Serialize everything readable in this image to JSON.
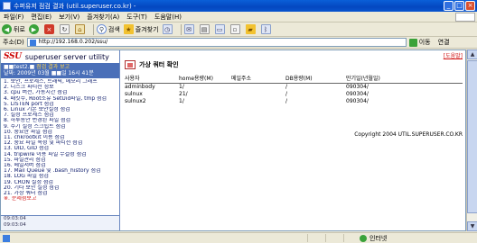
{
  "window": {
    "title": "수퍼유저 점검 결과 (util.superuser.co.kr) - ",
    "min_label": "_",
    "max_label": "□",
    "close_label": "×"
  },
  "menubar": [
    "파일(F)",
    "편집(E)",
    "보기(V)",
    "즐겨찾기(A)",
    "도구(T)",
    "도움말(H)"
  ],
  "toolbar": {
    "back_label": "뒤로",
    "search_label": "검색",
    "favorites_label": "즐겨찾기"
  },
  "address": {
    "label": "주소(D)",
    "url": "http://192.168.0.202/ssu/",
    "go_label": "이동",
    "links_label": "연결"
  },
  "sidebar": {
    "logo_mark": "SSU",
    "logo_text": "superuser server utility",
    "header_prefix": "■■test2.■",
    "header_warn": "점검 결과 보고",
    "header_line2": "날짜: 2009년 03월 ■■일 16시 41분",
    "items": [
      {
        "label": "1. 보안, 프로세스, 트래픽, 메모리 그래프",
        "red": false
      },
      {
        "label": "2. 디스크 파티션 정보",
        "red": false
      },
      {
        "label": "3. cpu 버전, 가동시간 점검",
        "red": false
      },
      {
        "label": "4. 패킷수, Root소유 SetUid파일, tmp 점검",
        "red": false
      },
      {
        "label": "5. LISTEN port 점검",
        "red": false
      },
      {
        "label": "6. Linux 기본 보안설정 점검",
        "red": false
      },
      {
        "label": "7. 설정 프로세스 점검",
        "red": false
      },
      {
        "label": "8. 하루동안 변경된 파일 점검",
        "red": false
      },
      {
        "label": "9. 주기 설정 스크립트 점검",
        "red": false
      },
      {
        "label": "10. 중요한 파일 점검",
        "red": false
      },
      {
        "label": "11. chkrootkit 이용 점검",
        "red": false
      },
      {
        "label": "12. 중요 파일 속성 및 파티션 점검",
        "red": false
      },
      {
        "label": "13. UID, GID 점검",
        "red": false
      },
      {
        "label": "14. tripwire 이용 파일 무결성 점검",
        "red": false
      },
      {
        "label": "15. 파일관리 점검",
        "red": false
      },
      {
        "label": "16. 메일서버 점검",
        "red": false
      },
      {
        "label": "17. Mail Queue 및 .bash_history 점검",
        "red": false
      },
      {
        "label": "18. LOG 파일 점검",
        "red": false
      },
      {
        "label": "19. CRON 설정 점검",
        "red": false
      },
      {
        "label": "20. 기타 보안 설정 점검",
        "red": false
      },
      {
        "label": "21. 가상 쿼터 점검",
        "red": false
      },
      {
        "label": "※. 문제점보고",
        "red": true
      }
    ],
    "foot_time1": "09:03:04",
    "foot_time2": "09:03:04"
  },
  "main": {
    "top_link": "[도움말]",
    "page_title": "가상 쿼터 확인",
    "columns": [
      "사용자",
      "home용량(M)",
      "메일주소",
      "DB용량(M)",
      "만기일(년월일)"
    ],
    "rows": [
      [
        "adminbody",
        "1/",
        "",
        "/",
        "090304/"
      ],
      [
        "sulnux",
        "21/",
        "",
        "/",
        "090304/"
      ],
      [
        "sulnux2",
        "1/",
        "",
        "/",
        "090304/"
      ]
    ],
    "copyright": "Copyright 2004  UTIL.SUPERUSER.CO.KR"
  },
  "statusbar": {
    "zone_label": "인터넷"
  }
}
